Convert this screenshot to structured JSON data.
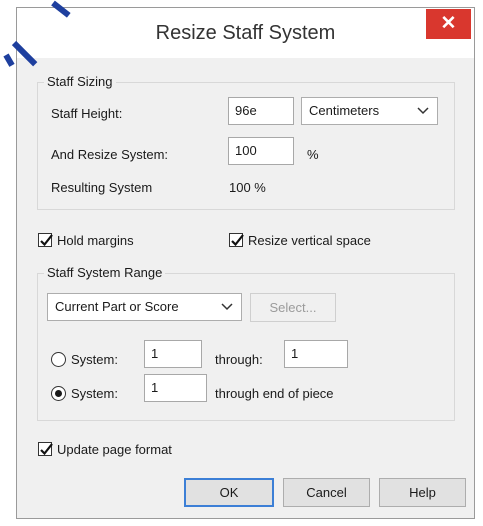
{
  "dialog": {
    "title": "Resize Staff System",
    "close_glyph": "✕"
  },
  "staff_sizing": {
    "group_label": "Staff Sizing",
    "height_label": "Staff Height:",
    "height_value": "96e",
    "unit_selected": "Centimeters",
    "resize_label": "And Resize System:",
    "resize_value": "100",
    "percent_sign": "%",
    "resulting_label": "Resulting System",
    "resulting_value": "100 %"
  },
  "options": {
    "hold_margins": {
      "label": "Hold margins",
      "checked": true
    },
    "resize_vertical": {
      "label": "Resize vertical space",
      "checked": true
    }
  },
  "range": {
    "group_label": "Staff System Range",
    "scope_selected": "Current Part or Score",
    "select_button": "Select...",
    "row1": {
      "label": "System:",
      "from": "1",
      "through_label": "through:",
      "to": "1",
      "selected": false
    },
    "row2": {
      "label": "System:",
      "from": "1",
      "suffix": "through end of piece",
      "selected": true
    }
  },
  "update_page_format": {
    "label": "Update page format",
    "checked": true
  },
  "buttons": {
    "ok": "OK",
    "cancel": "Cancel",
    "help": "Help"
  },
  "icons": {
    "close": "close-icon",
    "dropdown": "chevron-down-icon",
    "check": "checkmark-icon"
  },
  "colors": {
    "close_button": "#d9372e",
    "default_button_border": "#3c7fd6",
    "annotation_stroke": "#1e3f9e"
  }
}
